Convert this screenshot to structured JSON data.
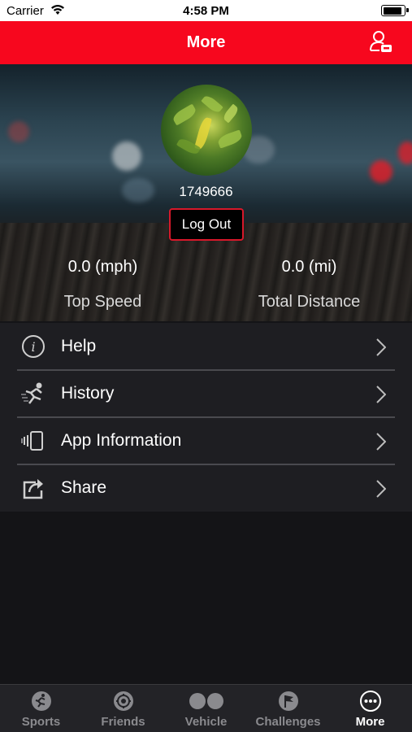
{
  "status_bar": {
    "carrier": "Carrier",
    "time": "4:58 PM"
  },
  "nav": {
    "title": "More"
  },
  "profile": {
    "username": "1749666",
    "logout_label": "Log Out",
    "top_speed_value": "0.0 (mph)",
    "top_speed_label": "Top Speed",
    "total_distance_value": "0.0 (mi)",
    "total_distance_label": "Total Distance"
  },
  "menu": {
    "items": [
      {
        "label": "Help",
        "icon": "info-icon"
      },
      {
        "label": "History",
        "icon": "runner-icon"
      },
      {
        "label": "App Information",
        "icon": "device-info-icon"
      },
      {
        "label": "Share",
        "icon": "share-icon"
      }
    ]
  },
  "tabs": [
    {
      "label": "Sports",
      "icon": "sports-icon",
      "active": false
    },
    {
      "label": "Friends",
      "icon": "friends-icon",
      "active": false
    },
    {
      "label": "Vehicle",
      "icon": "vehicle-icon",
      "active": false
    },
    {
      "label": "Challenges",
      "icon": "flag-icon",
      "active": false
    },
    {
      "label": "More",
      "icon": "more-icon",
      "active": true
    }
  ],
  "colors": {
    "accent": "#f7071e",
    "background": "#141417",
    "menu_bg": "#1e1e22",
    "tab_inactive": "#8a8a8e"
  }
}
